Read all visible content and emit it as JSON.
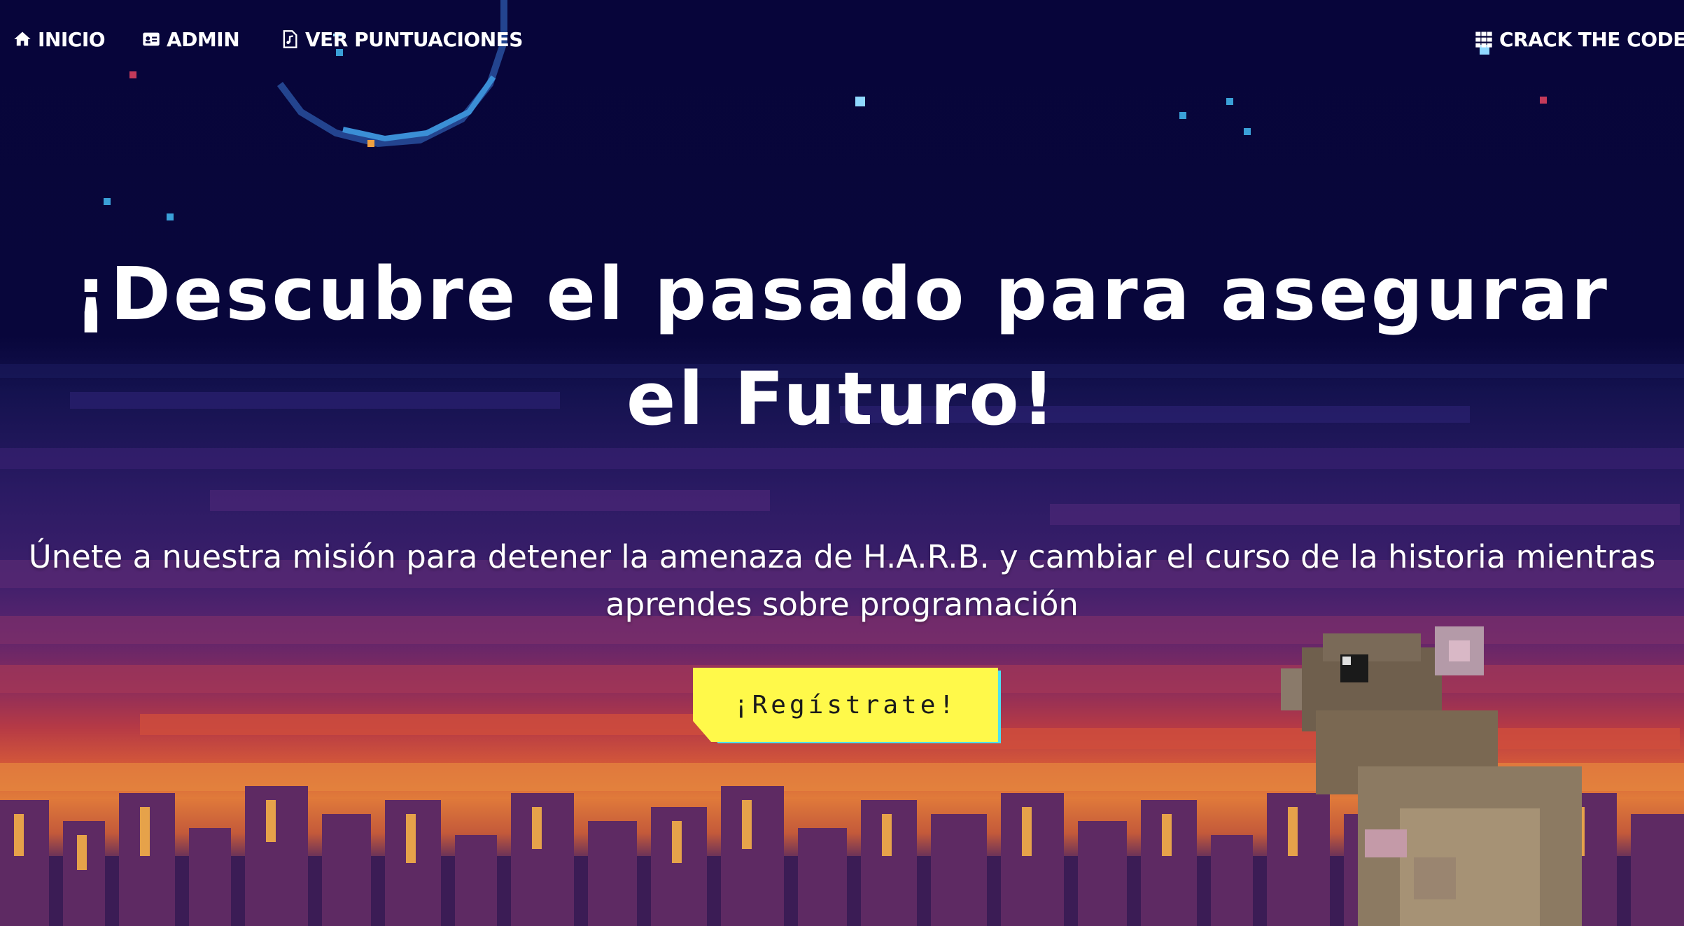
{
  "nav": {
    "items": [
      {
        "label": "INICIO",
        "icon": "home-icon"
      },
      {
        "label": "ADMIN",
        "icon": "id-card-icon"
      },
      {
        "label": "VER PUNTUACIONES",
        "icon": "file-music-icon"
      }
    ],
    "right": {
      "label": "CRACK THE CODE",
      "icon": "grid-icon"
    }
  },
  "hero": {
    "title": "¡Descubre el pasado para asegurar el Futuro!",
    "subtitle": "Únete a nuestra misión para detener la amenaza de H.A.R.B. y cambiar el curso de la historia mientras aprendes sobre programación",
    "cta_label": "¡Regístrate!"
  },
  "colors": {
    "background": "#08063a",
    "text": "#ffffff",
    "cta_bg": "#fff94a",
    "cta_shadow": "#4ee0f0"
  }
}
